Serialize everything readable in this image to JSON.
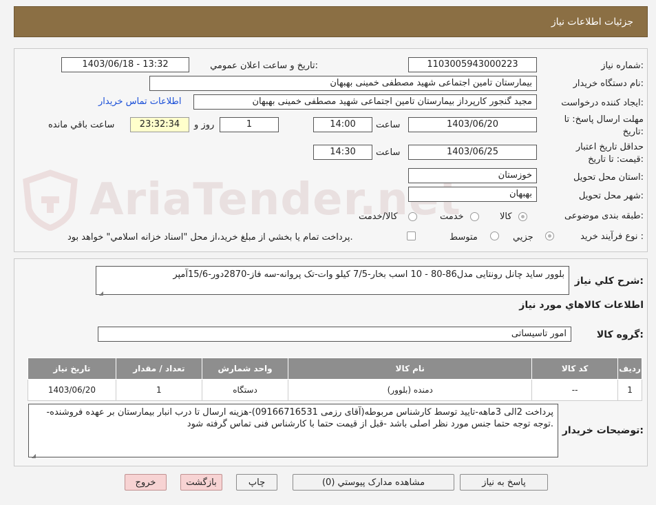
{
  "header": {
    "title": "جزئیات اطلاعات نیاز"
  },
  "watermark": {
    "text": "AriaTender.net"
  },
  "details": {
    "need_number_label": "شماره نیاز:",
    "need_number": "1103005943000223",
    "announce_label": "تاریخ و ساعت اعلان عمومي:",
    "announce_value": "1403/06/18 - 13:32",
    "buyer_org_label": "نام دستگاه خريدار:",
    "buyer_org": "بیمارستان تامین اجتماعی شهید مصطفی خمینی بهبهان",
    "creator_label": "ايجاد کننده درخواست:",
    "creator": "مجید گنجور کارپرداز بیمارستان تامین اجتماعی شهید مصطفی خمینی بهبهان",
    "contact_link": "اطلاعات تماس خريدار",
    "deadline_label_1": "مهلت ارسال پاسخ: تا",
    "deadline_label_2": "تاریخ:",
    "deadline_date": "1403/06/20",
    "time_label": "ساعت",
    "deadline_time": "14:00",
    "days_value": "1",
    "days_label": "روز و",
    "remaining_time": "23:32:34",
    "remaining_label": "ساعت باقي مانده",
    "validity_label_1": "حداقل تاريخ اعتبار",
    "validity_label_2": "قيمت: تا تاريخ:",
    "validity_date": "1403/06/25",
    "validity_time": "14:30",
    "province_label": "استان محل تحويل:",
    "province": "خوزستان",
    "city_label": "شهر محل تحويل:",
    "city": "بهبهان",
    "category_label": "طبقه بندی موضوعی:",
    "category_options": [
      "کالا",
      "خدمت",
      "کالا/خدمت"
    ],
    "category_selected": "کالا",
    "process_label": "نوع فرآيند خريد :",
    "process_options": [
      "جزيي",
      "متوسط"
    ],
    "process_selected": "جزيي",
    "process_note": "پرداخت تمام يا بخشي از مبلغ خريد،از محل \"اسناد خزانه اسلامي\" خواهد بود."
  },
  "summary": {
    "label": "شرح کلي نياز:",
    "text": "بلوور ساید چانل رونتایی مدل86-80 -  10 اسب بخار-7/5 کیلو وات-تک پروانه-سه فاز-2870دور-15/6آمپر"
  },
  "goods_section": {
    "title": "اطلاعات کالاهاي مورد نياز",
    "group_label": "گروه کالا:",
    "group_value": "امور تاسیساتی"
  },
  "table": {
    "headers": [
      "رديف",
      "کد کالا",
      "نام کالا",
      "واحد شمارش",
      "تعداد / مقدار",
      "تاريخ نياز"
    ],
    "rows": [
      [
        "1",
        "--",
        "دمنده (بلوور)",
        "دستگاه",
        "1",
        "1403/06/20"
      ]
    ]
  },
  "buyer_notes": {
    "label": "توضيحات خريدار:",
    "text": "پرداخت 2الی 3ماهه-تایید توسط کارشناس مربوطه(آقای رزمی 09166716531)-هزینه ارسال تا درب انبار بیمارستان بر عهده فروشنده-توجه توجه حتما جنس مورد نظر اصلی باشد -قبل از قیمت حتما با کارشناس فنی تماس گرفته شود."
  },
  "buttons": {
    "reply": "پاسخ به نياز",
    "attachments": "مشاهده مدارک پيوستي (0)",
    "print": "چاپ",
    "back": "بازگشت",
    "exit": "خروج"
  }
}
